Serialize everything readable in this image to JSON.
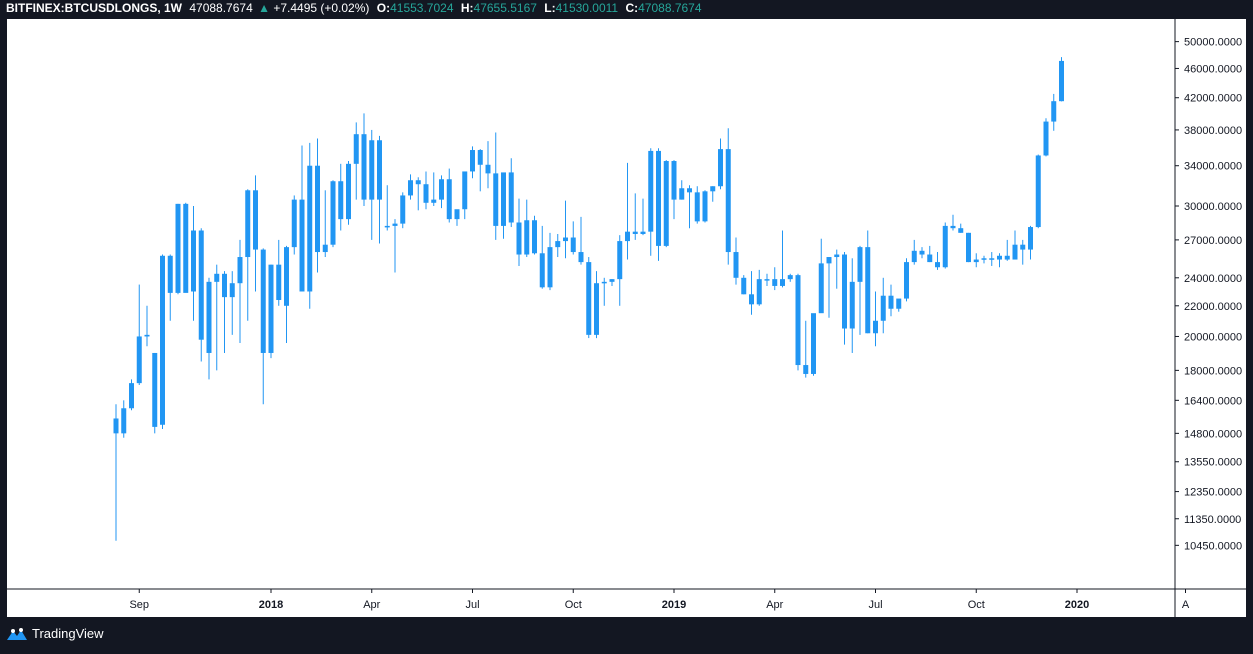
{
  "header": {
    "symbol": "BITFINEX:BTCUSDLONGS, 1W",
    "last": "47088.7674",
    "change": "+7.4495 (+0.02%)",
    "o_label": "O:",
    "o_value": "41553.7024",
    "h_label": "H:",
    "h_value": "47655.5167",
    "l_label": "L:",
    "l_value": "41530.0011",
    "c_label": "C:",
    "c_value": "47088.7674"
  },
  "footer": {
    "brand": "TradingView"
  },
  "colors": {
    "candle": "#2196f3",
    "background": "#131722",
    "plot": "#ffffff",
    "accent": "#26a69a"
  },
  "chart_data": {
    "type": "candlestick",
    "y_scale": "log",
    "ylim": [
      9800,
      52000
    ],
    "y_ticks": [
      "50000.0000",
      "46000.0000",
      "42000.0000",
      "38000.0000",
      "34000.0000",
      "30000.0000",
      "27000.0000",
      "24000.0000",
      "22000.0000",
      "20000.0000",
      "18000.0000",
      "16400.0000",
      "14800.0000",
      "13550.0000",
      "12350.0000",
      "11350.0000",
      "10450.0000"
    ],
    "x_ticks": [
      {
        "label": "Sep",
        "week": 3
      },
      {
        "label": "2018",
        "week": 20
      },
      {
        "label": "Apr",
        "week": 33
      },
      {
        "label": "Jul",
        "week": 46
      },
      {
        "label": "Oct",
        "week": 59
      },
      {
        "label": "2019",
        "week": 72
      },
      {
        "label": "Apr",
        "week": 85
      },
      {
        "label": "Jul",
        "week": 98
      },
      {
        "label": "Oct",
        "week": 111
      },
      {
        "label": "2020",
        "week": 124
      },
      {
        "label": "A",
        "week": 138
      }
    ],
    "candles": [
      [
        15500,
        16200,
        10600,
        14800
      ],
      [
        14800,
        16400,
        14600,
        16000
      ],
      [
        16000,
        17500,
        15900,
        17300
      ],
      [
        17300,
        23500,
        17200,
        20000
      ],
      [
        20000,
        22000,
        19400,
        20100
      ],
      [
        15100,
        19000,
        14800,
        19000
      ],
      [
        15200,
        25800,
        15000,
        25700
      ],
      [
        25700,
        25800,
        21000,
        22900
      ],
      [
        22900,
        30200,
        22800,
        30200
      ],
      [
        30200,
        30300,
        23000,
        22900
      ],
      [
        23000,
        30000,
        21000,
        27800
      ],
      [
        27800,
        28000,
        18500,
        19800
      ],
      [
        19000,
        24000,
        17500,
        23700
      ],
      [
        23700,
        25000,
        18000,
        24300
      ],
      [
        24300,
        24500,
        19000,
        22600
      ],
      [
        22600,
        24500,
        20100,
        23600
      ],
      [
        23600,
        27000,
        19600,
        25600
      ],
      [
        25600,
        31600,
        21000,
        31500
      ],
      [
        31500,
        33000,
        23000,
        26200
      ],
      [
        26200,
        26300,
        16200,
        19000
      ],
      [
        19000,
        25000,
        18700,
        25000
      ],
      [
        25000,
        27000,
        22000,
        22400
      ],
      [
        22000,
        26500,
        19600,
        26400
      ],
      [
        26400,
        31000,
        25800,
        30600
      ],
      [
        30600,
        36200,
        23000,
        23000
      ],
      [
        23000,
        36500,
        21800,
        34000
      ],
      [
        34000,
        37000,
        24400,
        26000
      ],
      [
        26000,
        31500,
        25600,
        26600
      ],
      [
        26600,
        32500,
        26400,
        32400
      ],
      [
        32400,
        34200,
        27800,
        28800
      ],
      [
        28800,
        34500,
        28300,
        34200
      ],
      [
        34200,
        38900,
        30600,
        37500
      ],
      [
        37500,
        40000,
        30000,
        30600
      ],
      [
        30600,
        38000,
        27000,
        36800
      ],
      [
        36800,
        37300,
        26700,
        30600
      ],
      [
        28200,
        32000,
        27800,
        28200
      ],
      [
        28200,
        28800,
        24400,
        28400
      ],
      [
        28400,
        31300,
        28000,
        31000
      ],
      [
        31000,
        33100,
        30600,
        32500
      ],
      [
        32500,
        32800,
        29600,
        32100
      ],
      [
        32100,
        33400,
        29700,
        30300
      ],
      [
        30300,
        33300,
        30000,
        30600
      ],
      [
        30600,
        33000,
        29800,
        32600
      ],
      [
        32600,
        33700,
        28500,
        28800
      ],
      [
        28800,
        29600,
        28200,
        29700
      ],
      [
        29700,
        33100,
        28800,
        33400
      ],
      [
        33400,
        36100,
        32700,
        35700
      ],
      [
        35700,
        35800,
        31400,
        34100
      ],
      [
        34100,
        36700,
        31700,
        33200
      ],
      [
        33200,
        37700,
        27000,
        28200
      ],
      [
        28200,
        33100,
        27100,
        33300
      ],
      [
        33300,
        34800,
        28100,
        28500
      ],
      [
        28500,
        30700,
        24900,
        25800
      ],
      [
        25800,
        30600,
        25600,
        28700
      ],
      [
        28700,
        29100,
        25800,
        25900
      ],
      [
        25900,
        28200,
        23200,
        23300
      ],
      [
        23300,
        27600,
        23100,
        26400
      ],
      [
        26400,
        27500,
        25600,
        26900
      ],
      [
        26900,
        30500,
        25500,
        27200
      ],
      [
        27200,
        28600,
        25800,
        26000
      ],
      [
        26000,
        29000,
        25000,
        25200
      ],
      [
        25200,
        25600,
        19900,
        20100
      ],
      [
        20100,
        24500,
        19900,
        23600
      ],
      [
        23600,
        24000,
        22000,
        23700
      ],
      [
        23700,
        23900,
        23400,
        23900
      ],
      [
        23900,
        27400,
        22000,
        26900
      ],
      [
        26900,
        34300,
        25400,
        27700
      ],
      [
        27700,
        31200,
        27000,
        27500
      ],
      [
        27500,
        30700,
        27400,
        27700
      ],
      [
        27700,
        35900,
        25700,
        35600
      ],
      [
        35600,
        35900,
        25300,
        26500
      ],
      [
        26500,
        34600,
        26400,
        34500
      ],
      [
        34500,
        34600,
        28800,
        30600
      ],
      [
        30600,
        32500,
        30600,
        31700
      ],
      [
        31700,
        32000,
        28000,
        31300
      ],
      [
        31300,
        31900,
        28400,
        28600
      ],
      [
        28600,
        31500,
        28500,
        31400
      ],
      [
        31400,
        31900,
        30400,
        31900
      ],
      [
        31900,
        37000,
        31600,
        35800
      ],
      [
        35800,
        38200,
        25000,
        26000
      ],
      [
        26000,
        27200,
        23500,
        24000
      ],
      [
        24000,
        24200,
        22800,
        22800
      ],
      [
        22800,
        24500,
        21400,
        22100
      ],
      [
        22100,
        24600,
        22000,
        23900
      ],
      [
        23900,
        24300,
        23400,
        23900
      ],
      [
        23900,
        24800,
        23100,
        23400
      ],
      [
        23400,
        27800,
        23300,
        23900
      ],
      [
        23900,
        24300,
        23700,
        24200
      ],
      [
        24200,
        24300,
        18000,
        18300
      ],
      [
        18300,
        21000,
        17600,
        17800
      ],
      [
        17800,
        20600,
        17700,
        21500
      ],
      [
        21500,
        27100,
        22000,
        25100
      ],
      [
        25100,
        25400,
        21200,
        25600
      ],
      [
        25600,
        26200,
        23200,
        25800
      ],
      [
        25800,
        26000,
        19500,
        20500
      ],
      [
        20500,
        25500,
        19000,
        23700
      ],
      [
        23700,
        26500,
        20100,
        26400
      ],
      [
        26400,
        27800,
        20200,
        20200
      ],
      [
        20200,
        23000,
        19400,
        21000
      ],
      [
        21000,
        24000,
        20200,
        22700
      ],
      [
        22700,
        23500,
        21300,
        21800
      ],
      [
        21800,
        22400,
        21600,
        22500
      ],
      [
        22500,
        25500,
        22300,
        25200
      ],
      [
        25200,
        27000,
        25000,
        26100
      ],
      [
        26100,
        26400,
        25500,
        25800
      ],
      [
        25800,
        26500,
        25200,
        25200
      ],
      [
        25200,
        26000,
        24600,
        24800
      ],
      [
        24800,
        28500,
        24700,
        28200
      ],
      [
        28200,
        29200,
        27800,
        28000
      ],
      [
        28000,
        28400,
        27600,
        27600
      ],
      [
        27600,
        27600,
        25200,
        25200
      ],
      [
        25200,
        25900,
        24800,
        25400
      ],
      [
        25400,
        25700,
        25100,
        25500
      ],
      [
        25500,
        26000,
        24900,
        25400
      ],
      [
        25400,
        25900,
        24800,
        25700
      ],
      [
        25700,
        27000,
        25300,
        25400
      ],
      [
        25400,
        27800,
        25400,
        26600
      ],
      [
        26600,
        27000,
        25000,
        26200
      ],
      [
        26200,
        28200,
        25400,
        28100
      ],
      [
        28100,
        35200,
        28000,
        35100
      ],
      [
        35100,
        39400,
        35000,
        39000
      ],
      [
        39000,
        42500,
        37900,
        41550
      ],
      [
        41550,
        47655,
        41530,
        47089
      ]
    ]
  }
}
